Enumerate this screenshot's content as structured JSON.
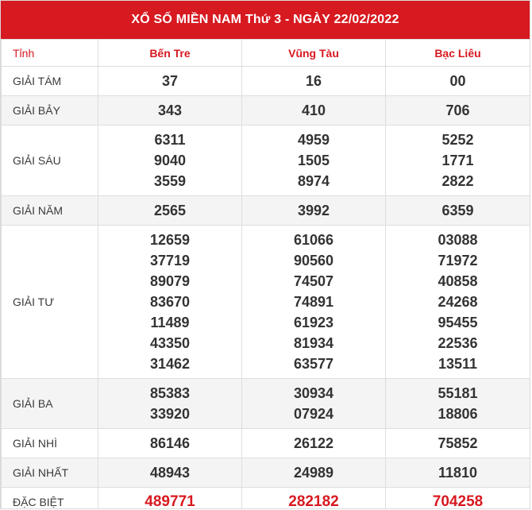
{
  "title": "XỔ SỐ MIỀN NAM Thứ 3 - NGÀY 22/02/2022",
  "header": {
    "label": "Tỉnh",
    "provinces": [
      "Bến Tre",
      "Vũng Tàu",
      "Bạc Liêu"
    ]
  },
  "prizes": [
    {
      "label": "GIẢI TÁM",
      "values": [
        [
          "37"
        ],
        [
          "16"
        ],
        [
          "00"
        ]
      ]
    },
    {
      "label": "GIẢI BẢY",
      "values": [
        [
          "343"
        ],
        [
          "410"
        ],
        [
          "706"
        ]
      ]
    },
    {
      "label": "GIẢI SÁU",
      "values": [
        [
          "6311",
          "9040",
          "3559"
        ],
        [
          "4959",
          "1505",
          "8974"
        ],
        [
          "5252",
          "1771",
          "2822"
        ]
      ]
    },
    {
      "label": "GIẢI NĂM",
      "values": [
        [
          "2565"
        ],
        [
          "3992"
        ],
        [
          "6359"
        ]
      ]
    },
    {
      "label": "GIẢI TƯ",
      "values": [
        [
          "12659",
          "37719",
          "89079",
          "83670",
          "11489",
          "43350",
          "31462"
        ],
        [
          "61066",
          "90560",
          "74507",
          "74891",
          "61923",
          "81934",
          "63577"
        ],
        [
          "03088",
          "71972",
          "40858",
          "24268",
          "95455",
          "22536",
          "13511"
        ]
      ]
    },
    {
      "label": "GIẢI BA",
      "values": [
        [
          "85383",
          "33920"
        ],
        [
          "30934",
          "07924"
        ],
        [
          "55181",
          "18806"
        ]
      ]
    },
    {
      "label": "GIẢI NHÌ",
      "values": [
        [
          "86146"
        ],
        [
          "26122"
        ],
        [
          "75852"
        ]
      ]
    },
    {
      "label": "GIẢI NHẤT",
      "values": [
        [
          "48943"
        ],
        [
          "24989"
        ],
        [
          "11810"
        ]
      ]
    },
    {
      "label": "ĐẶC BIỆT",
      "values": [
        [
          "489771"
        ],
        [
          "282182"
        ],
        [
          "704258"
        ]
      ]
    }
  ]
}
